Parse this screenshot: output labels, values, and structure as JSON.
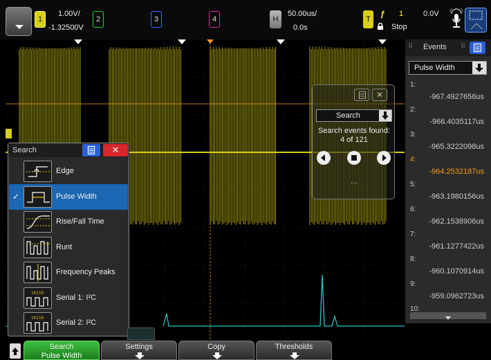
{
  "topbar": {
    "ch1": {
      "label": "1",
      "scale": "1.00V/",
      "offset": "-1.32500V"
    },
    "ch2": {
      "label": "2"
    },
    "ch3": {
      "label": "3"
    },
    "ch4": {
      "label": "4"
    },
    "horizontal": {
      "label": "H",
      "scale": "50.00us/",
      "delay": "0.0s"
    },
    "trigger": {
      "label": "T",
      "source": "1",
      "level": "0.0V",
      "mode": "Stop"
    },
    "colors": {
      "ch1": "#d9cf14",
      "ch2": "#1fd63a",
      "ch3": "#3e6dff",
      "ch4": "#d72a99"
    }
  },
  "events": {
    "title": "Events",
    "type": "Pulse Width",
    "items": [
      {
        "index": "1:",
        "time": "-967.4927656us"
      },
      {
        "index": "2:",
        "time": "-966.4035117us"
      },
      {
        "index": "3:",
        "time": "-965.3222098us"
      },
      {
        "index": "4:",
        "time": "-964.2532187us",
        "selected": true
      },
      {
        "index": "5:",
        "time": "-963.1980156us"
      },
      {
        "index": "6:",
        "time": "-962.1538906us"
      },
      {
        "index": "7:",
        "time": "-961.1277422us"
      },
      {
        "index": "8:",
        "time": "-960.1070914us"
      },
      {
        "index": "9:",
        "time": "-959.0962723us"
      },
      {
        "index": "10:",
        "time": ""
      }
    ]
  },
  "search_overlay": {
    "select_label": "Search",
    "found_label": "Search events found:",
    "count": "4 of 121",
    "more": "..."
  },
  "search_menu": {
    "title": "Search",
    "items": [
      {
        "label": "Edge",
        "icon": "edge-icon"
      },
      {
        "label": "Pulse Width",
        "icon": "pulse-width-icon",
        "selected": true
      },
      {
        "label": "Rise/Fall Time",
        "icon": "rise-fall-icon"
      },
      {
        "label": "Runt",
        "icon": "runt-icon"
      },
      {
        "label": "Frequency Peaks",
        "icon": "frequency-peaks-icon"
      },
      {
        "label": "Serial 1: I²C",
        "icon": "serial-1-icon"
      },
      {
        "label": "Serial 2: I²C",
        "icon": "serial-2-icon"
      }
    ]
  },
  "softkeys": {
    "search": {
      "label": "Search",
      "value": "Pulse Width"
    },
    "settings": {
      "label": "Settings"
    },
    "copy": {
      "label": "Copy"
    },
    "thresholds": {
      "label": "Thresholds"
    }
  }
}
